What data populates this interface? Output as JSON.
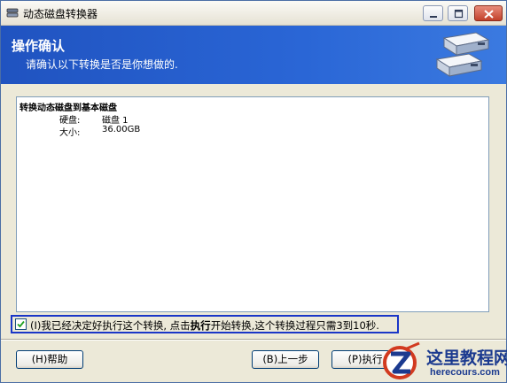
{
  "window": {
    "title": "动态磁盘转换器",
    "icon": "disk-converter-icon"
  },
  "banner": {
    "title": "操作确认",
    "subtitle": "请确认以下转换是否是你想做的.",
    "icon": "hard-disks-icon"
  },
  "details": {
    "heading": "转换动态磁盘到基本磁盘",
    "rows": [
      {
        "label": "硬盘:",
        "value": "磁盘 1"
      },
      {
        "label": "大小:",
        "value": "36.00GB"
      }
    ]
  },
  "confirm": {
    "checked": true,
    "text_prefix": "(I)我已经决定好执行这个转换, 点击",
    "text_bold": "执行",
    "text_suffix": "开始转换,这个转换过程只需3到10秒."
  },
  "buttons": {
    "help": "(H)帮助",
    "back": "(B)上一步",
    "execute": "(P)执行"
  },
  "watermark": {
    "text": "这里教程网",
    "url": "herecours.com"
  }
}
